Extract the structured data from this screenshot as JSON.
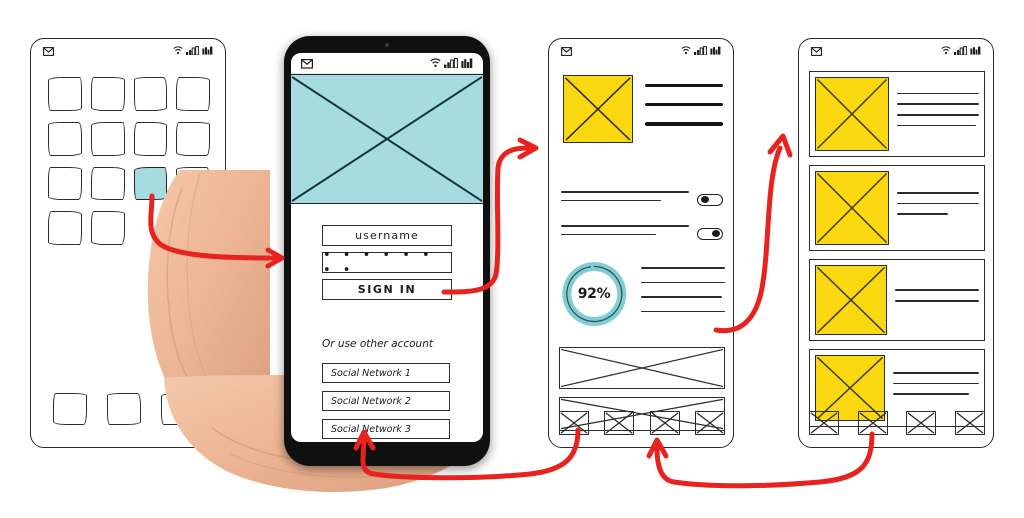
{
  "meta": {
    "scene_title": "Mobile app wireframe flow with hand holding phone",
    "accent_teal": "#a6dbe1",
    "accent_yellow": "#fad80f",
    "arrow_red": "#e8231f",
    "sketch_ink": "#2b2b2b"
  },
  "status_bar": {
    "left_icon": "envelope-icon",
    "right_icons": [
      "wifi-icon",
      "signal-icon",
      "battery-icon"
    ]
  },
  "screen1": {
    "name": "App grid / home screen",
    "app_icons": [
      {
        "id": "app-1",
        "selected": false
      },
      {
        "id": "app-2",
        "selected": false
      },
      {
        "id": "app-3",
        "selected": false
      },
      {
        "id": "app-4",
        "selected": false
      },
      {
        "id": "app-5",
        "selected": false
      },
      {
        "id": "app-6",
        "selected": false
      },
      {
        "id": "app-7",
        "selected": false
      },
      {
        "id": "app-8",
        "selected": false
      },
      {
        "id": "app-9",
        "selected": false
      },
      {
        "id": "app-10",
        "selected": false
      },
      {
        "id": "app-11",
        "selected": true
      },
      {
        "id": "app-12",
        "selected": false
      },
      {
        "id": "app-13",
        "selected": false
      },
      {
        "id": "app-14",
        "selected": false
      }
    ],
    "dock_icons": [
      "dock-1",
      "dock-2",
      "dock-3"
    ]
  },
  "phone": {
    "name": "Login screen on physical phone",
    "hero_placeholder": "image-placeholder",
    "username_value": "username",
    "password_value": "• • • • • • • •",
    "sign_in_label": "SIGN IN",
    "other_account_label": "Or use other account",
    "social_buttons": [
      "Social Network 1",
      "Social Network 2",
      "Social Network 3"
    ]
  },
  "screen3": {
    "name": "Dashboard / settings screen",
    "hero_placeholder": "image-placeholder",
    "hero_lines": 3,
    "toggles": [
      {
        "id": "toggle-1",
        "state": "off"
      },
      {
        "id": "toggle-2",
        "state": "on"
      }
    ],
    "progress": {
      "label": "92%",
      "value": 92,
      "max": 100
    },
    "ring_lines": 4,
    "banner_placeholders": [
      "banner-1",
      "banner-2"
    ],
    "bottom_nav": [
      "nav-1",
      "nav-2",
      "nav-3",
      "nav-4"
    ]
  },
  "screen4": {
    "name": "Card list / feed screen",
    "cards": [
      {
        "id": "card-1",
        "thumb": "image-placeholder",
        "lines": 4
      },
      {
        "id": "card-2",
        "thumb": "image-placeholder",
        "lines": 3
      },
      {
        "id": "card-3",
        "thumb": "image-placeholder",
        "lines": 2
      },
      {
        "id": "card-4",
        "thumb": "image-placeholder",
        "lines": 3
      }
    ],
    "bottom_nav": [
      "nav-1",
      "nav-2",
      "nav-3",
      "nav-4"
    ]
  },
  "flow_arrows": [
    {
      "id": "arrow-grid-to-phone",
      "from": "screen1.app-11",
      "to": "phone.login"
    },
    {
      "id": "arrow-signin-to-dash",
      "from": "phone.sign_in_button",
      "to": "screen3.top"
    },
    {
      "id": "arrow-dash-to-list",
      "from": "screen3.banner",
      "to": "screen4.top"
    },
    {
      "id": "arrow-dashnav-to-phone",
      "from": "screen3.bottom_nav",
      "to": "phone.bottom"
    },
    {
      "id": "arrow-listnav-to-dash",
      "from": "screen4.bottom_nav",
      "to": "screen3.bottom_nav"
    }
  ]
}
